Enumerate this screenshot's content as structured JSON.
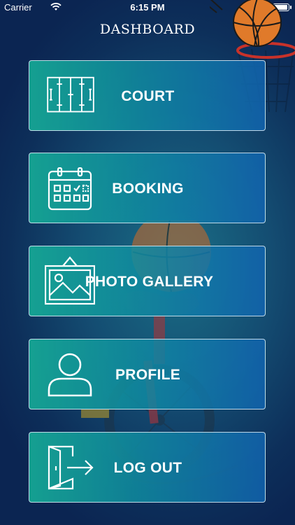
{
  "status_bar": {
    "carrier": "Carrier",
    "time": "6:15 PM",
    "battery_level_pct": 100
  },
  "header": {
    "title": "DASHBOARD"
  },
  "menu": [
    {
      "label": "COURT",
      "icon": "basketball-court-icon"
    },
    {
      "label": "BOOKING",
      "icon": "calendar-icon"
    },
    {
      "label": "PHOTO GALLERY",
      "icon": "picture-frame-icon"
    },
    {
      "label": "PROFILE",
      "icon": "user-icon"
    },
    {
      "label": "LOG OUT",
      "icon": "logout-door-icon"
    }
  ],
  "colors": {
    "button_start": "#16aa96",
    "button_end": "#1264af",
    "background": "#0d2f5a"
  }
}
